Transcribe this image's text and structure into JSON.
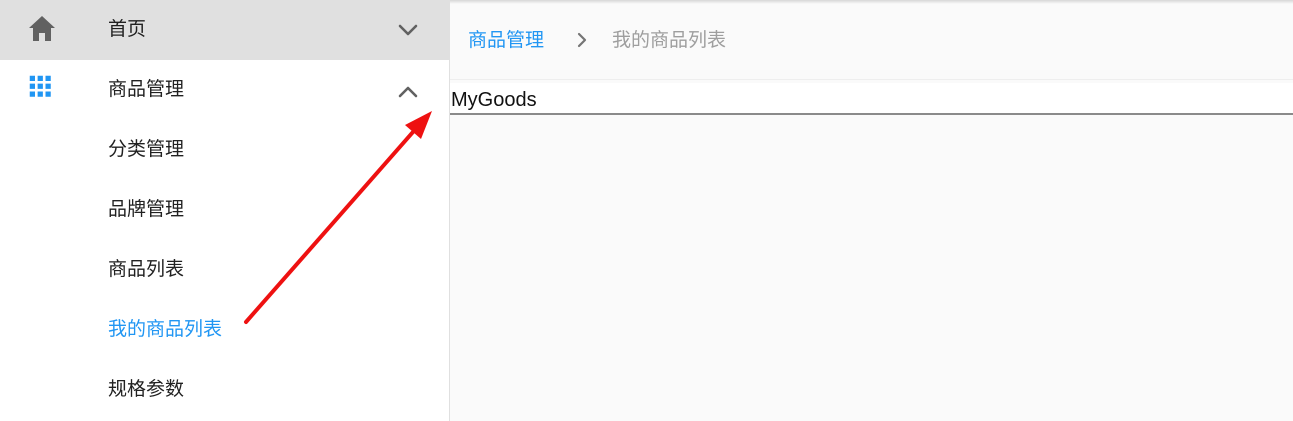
{
  "sidebar": {
    "items": [
      {
        "label": "首页",
        "icon": "home-icon",
        "state": "collapsed"
      },
      {
        "label": "商品管理",
        "icon": "grid-apps-icon",
        "state": "expanded",
        "children": [
          {
            "label": "分类管理"
          },
          {
            "label": "品牌管理"
          },
          {
            "label": "商品列表"
          },
          {
            "label": "我的商品列表",
            "selected": true
          },
          {
            "label": "规格参数"
          }
        ]
      }
    ]
  },
  "breadcrumb": {
    "parent": "商品管理",
    "current": "我的商品列表"
  },
  "main": {
    "content": "MyGoods"
  },
  "colors": {
    "accent": "#2196f3",
    "active_row_bg": "#e0e0e0",
    "annotation_arrow": "#ee1111"
  }
}
